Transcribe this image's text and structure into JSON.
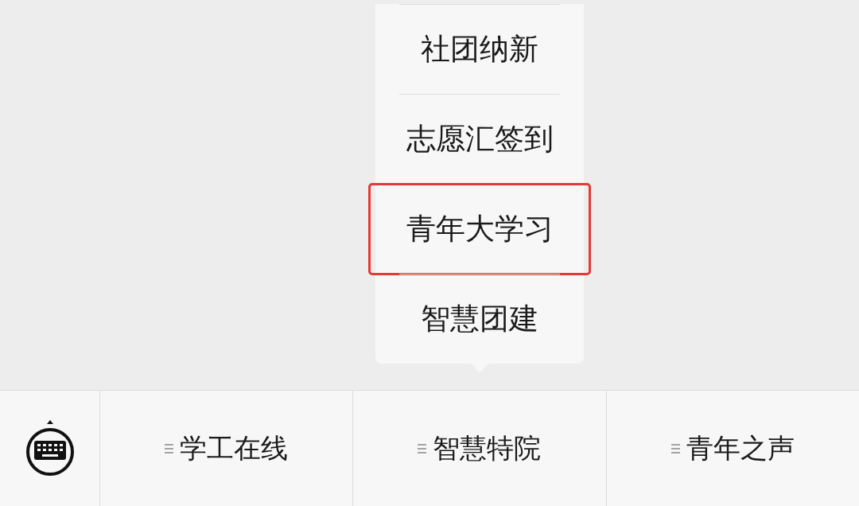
{
  "popup_menu": {
    "items": [
      {
        "label": "社团纳新",
        "highlighted": false
      },
      {
        "label": "志愿汇签到",
        "highlighted": false
      },
      {
        "label": "青年大学习",
        "highlighted": true
      },
      {
        "label": "智慧团建",
        "highlighted": false
      }
    ]
  },
  "menu_bar": {
    "items": [
      {
        "label": "学工在线"
      },
      {
        "label": "智慧特院"
      },
      {
        "label": "青年之声"
      }
    ]
  }
}
